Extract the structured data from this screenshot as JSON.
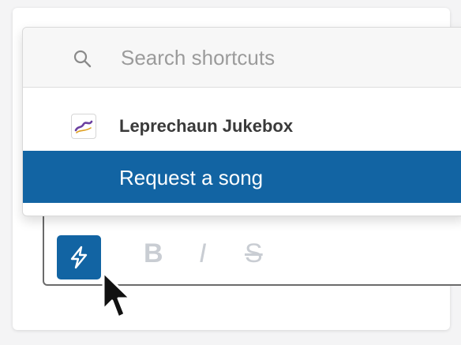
{
  "search": {
    "placeholder": "Search shortcuts"
  },
  "app": {
    "name": "Leprechaun Jukebox",
    "logo_icon": "jukebox-logo-icon"
  },
  "shortcut": {
    "label": "Request a song"
  },
  "toolbar": {
    "bold": "B",
    "italic": "I",
    "strike": "S",
    "shortcuts_icon": "lightning-bolt-icon"
  },
  "colors": {
    "accent": "#1264a3",
    "selected_text": "#ffffff",
    "muted": "#c9cdd3"
  }
}
